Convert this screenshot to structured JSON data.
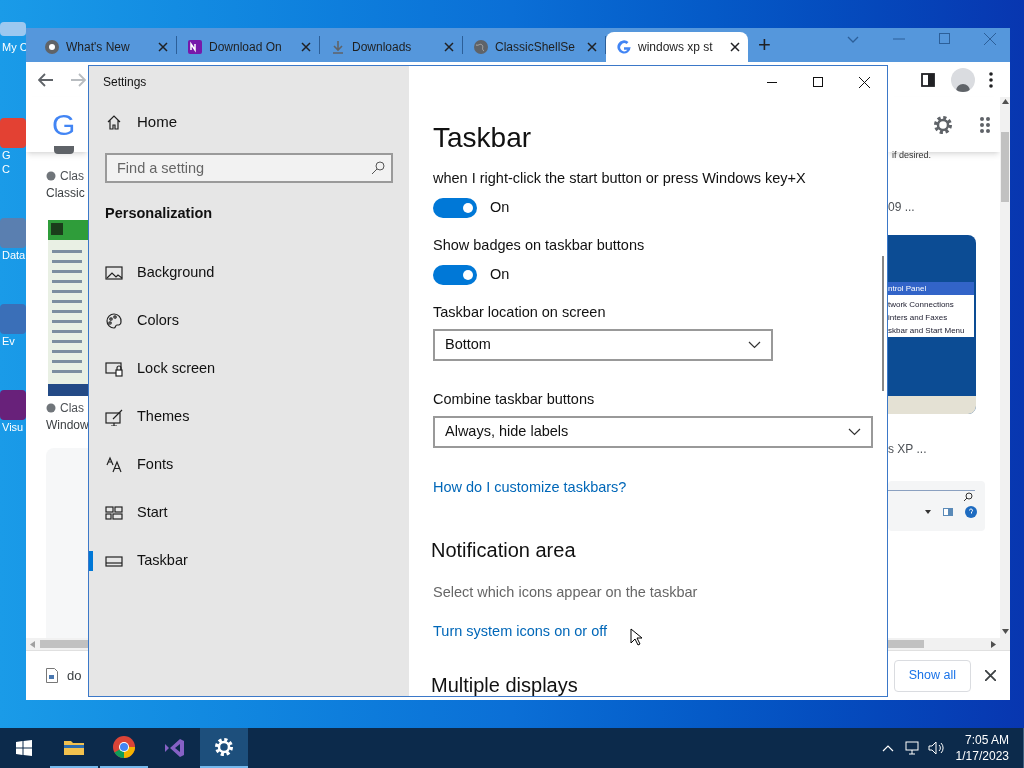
{
  "desktop_icons": [
    {
      "kind": "computer",
      "lines": [
        "My C"
      ]
    },
    {
      "kind": "chrome",
      "lines": [
        "G",
        "C"
      ]
    },
    {
      "kind": "database",
      "lines": [
        "Data"
      ]
    },
    {
      "kind": "event",
      "lines": [
        "Ev"
      ]
    },
    {
      "kind": "studio",
      "lines": [
        "Visu"
      ]
    }
  ],
  "browser": {
    "tabs": [
      {
        "kind": "chrome",
        "title": "What's New",
        "selected": false
      },
      {
        "kind": "onenote",
        "title": "Download On",
        "selected": false
      },
      {
        "kind": "download",
        "title": "Downloads",
        "selected": false
      },
      {
        "kind": "globe",
        "title": "ClassicShellSe",
        "selected": false
      },
      {
        "kind": "google",
        "title": "windows xp st",
        "selected": true
      }
    ],
    "new_tab": "+",
    "logo": "G",
    "left_results": [
      {
        "source": "Clas",
        "title": "Classic"
      },
      {
        "source": "Clas",
        "title": "Window"
      }
    ],
    "right_results": {
      "snippet": "if desired.",
      "title_1": "09 ...",
      "thumb_lines": [
        "ntrol Panel",
        "twork Connections",
        "inters and Faxes",
        "skbar and Start Menu"
      ],
      "title_2": "s XP ..."
    },
    "download_shelf": {
      "file": "do",
      "button": "Show all"
    }
  },
  "settings": {
    "title": "Settings",
    "home": "Home",
    "search": {
      "placeholder": "Find a setting"
    },
    "section": "Personalization",
    "nav": [
      {
        "kind": "background",
        "label": "Background",
        "selected": false
      },
      {
        "kind": "colors",
        "label": "Colors",
        "selected": false
      },
      {
        "kind": "lock",
        "label": "Lock screen",
        "selected": false
      },
      {
        "kind": "themes",
        "label": "Themes",
        "selected": false
      },
      {
        "kind": "fonts",
        "label": "Fonts",
        "selected": false
      },
      {
        "kind": "start",
        "label": "Start",
        "selected": false
      },
      {
        "kind": "taskbar",
        "label": "Taskbar",
        "selected": true
      }
    ],
    "page_title": "Taskbar",
    "content": [
      {
        "kind": "text",
        "text": "when I right-click the start button or press Windows key+X"
      },
      {
        "kind": "toggle",
        "on": true,
        "state": "On"
      },
      {
        "kind": "text",
        "text": "Show badges on taskbar buttons"
      },
      {
        "kind": "toggle",
        "on": true,
        "state": "On"
      },
      {
        "kind": "text",
        "text": "Taskbar location on screen"
      },
      {
        "kind": "dropdown",
        "value": "Bottom",
        "wide": false
      },
      {
        "kind": "text",
        "text": "Combine taskbar buttons"
      },
      {
        "kind": "dropdown",
        "value": "Always, hide labels",
        "wide": true
      },
      {
        "kind": "link",
        "text": "How do I customize taskbars?"
      },
      {
        "kind": "heading",
        "text": "Notification area"
      },
      {
        "kind": "description",
        "text": "Select which icons appear on the taskbar"
      },
      {
        "kind": "link",
        "text": "Turn system icons on or off"
      },
      {
        "kind": "heading",
        "text": "Multiple displays"
      }
    ]
  },
  "taskbar": {
    "apps": [
      {
        "kind": "explorer",
        "selected": false,
        "running": true
      },
      {
        "kind": "chrome",
        "selected": false,
        "running": true
      },
      {
        "kind": "studio",
        "selected": false,
        "running": false
      },
      {
        "kind": "settings",
        "selected": true,
        "running": true
      }
    ],
    "time": "7:05 AM",
    "date": "1/17/2023"
  }
}
